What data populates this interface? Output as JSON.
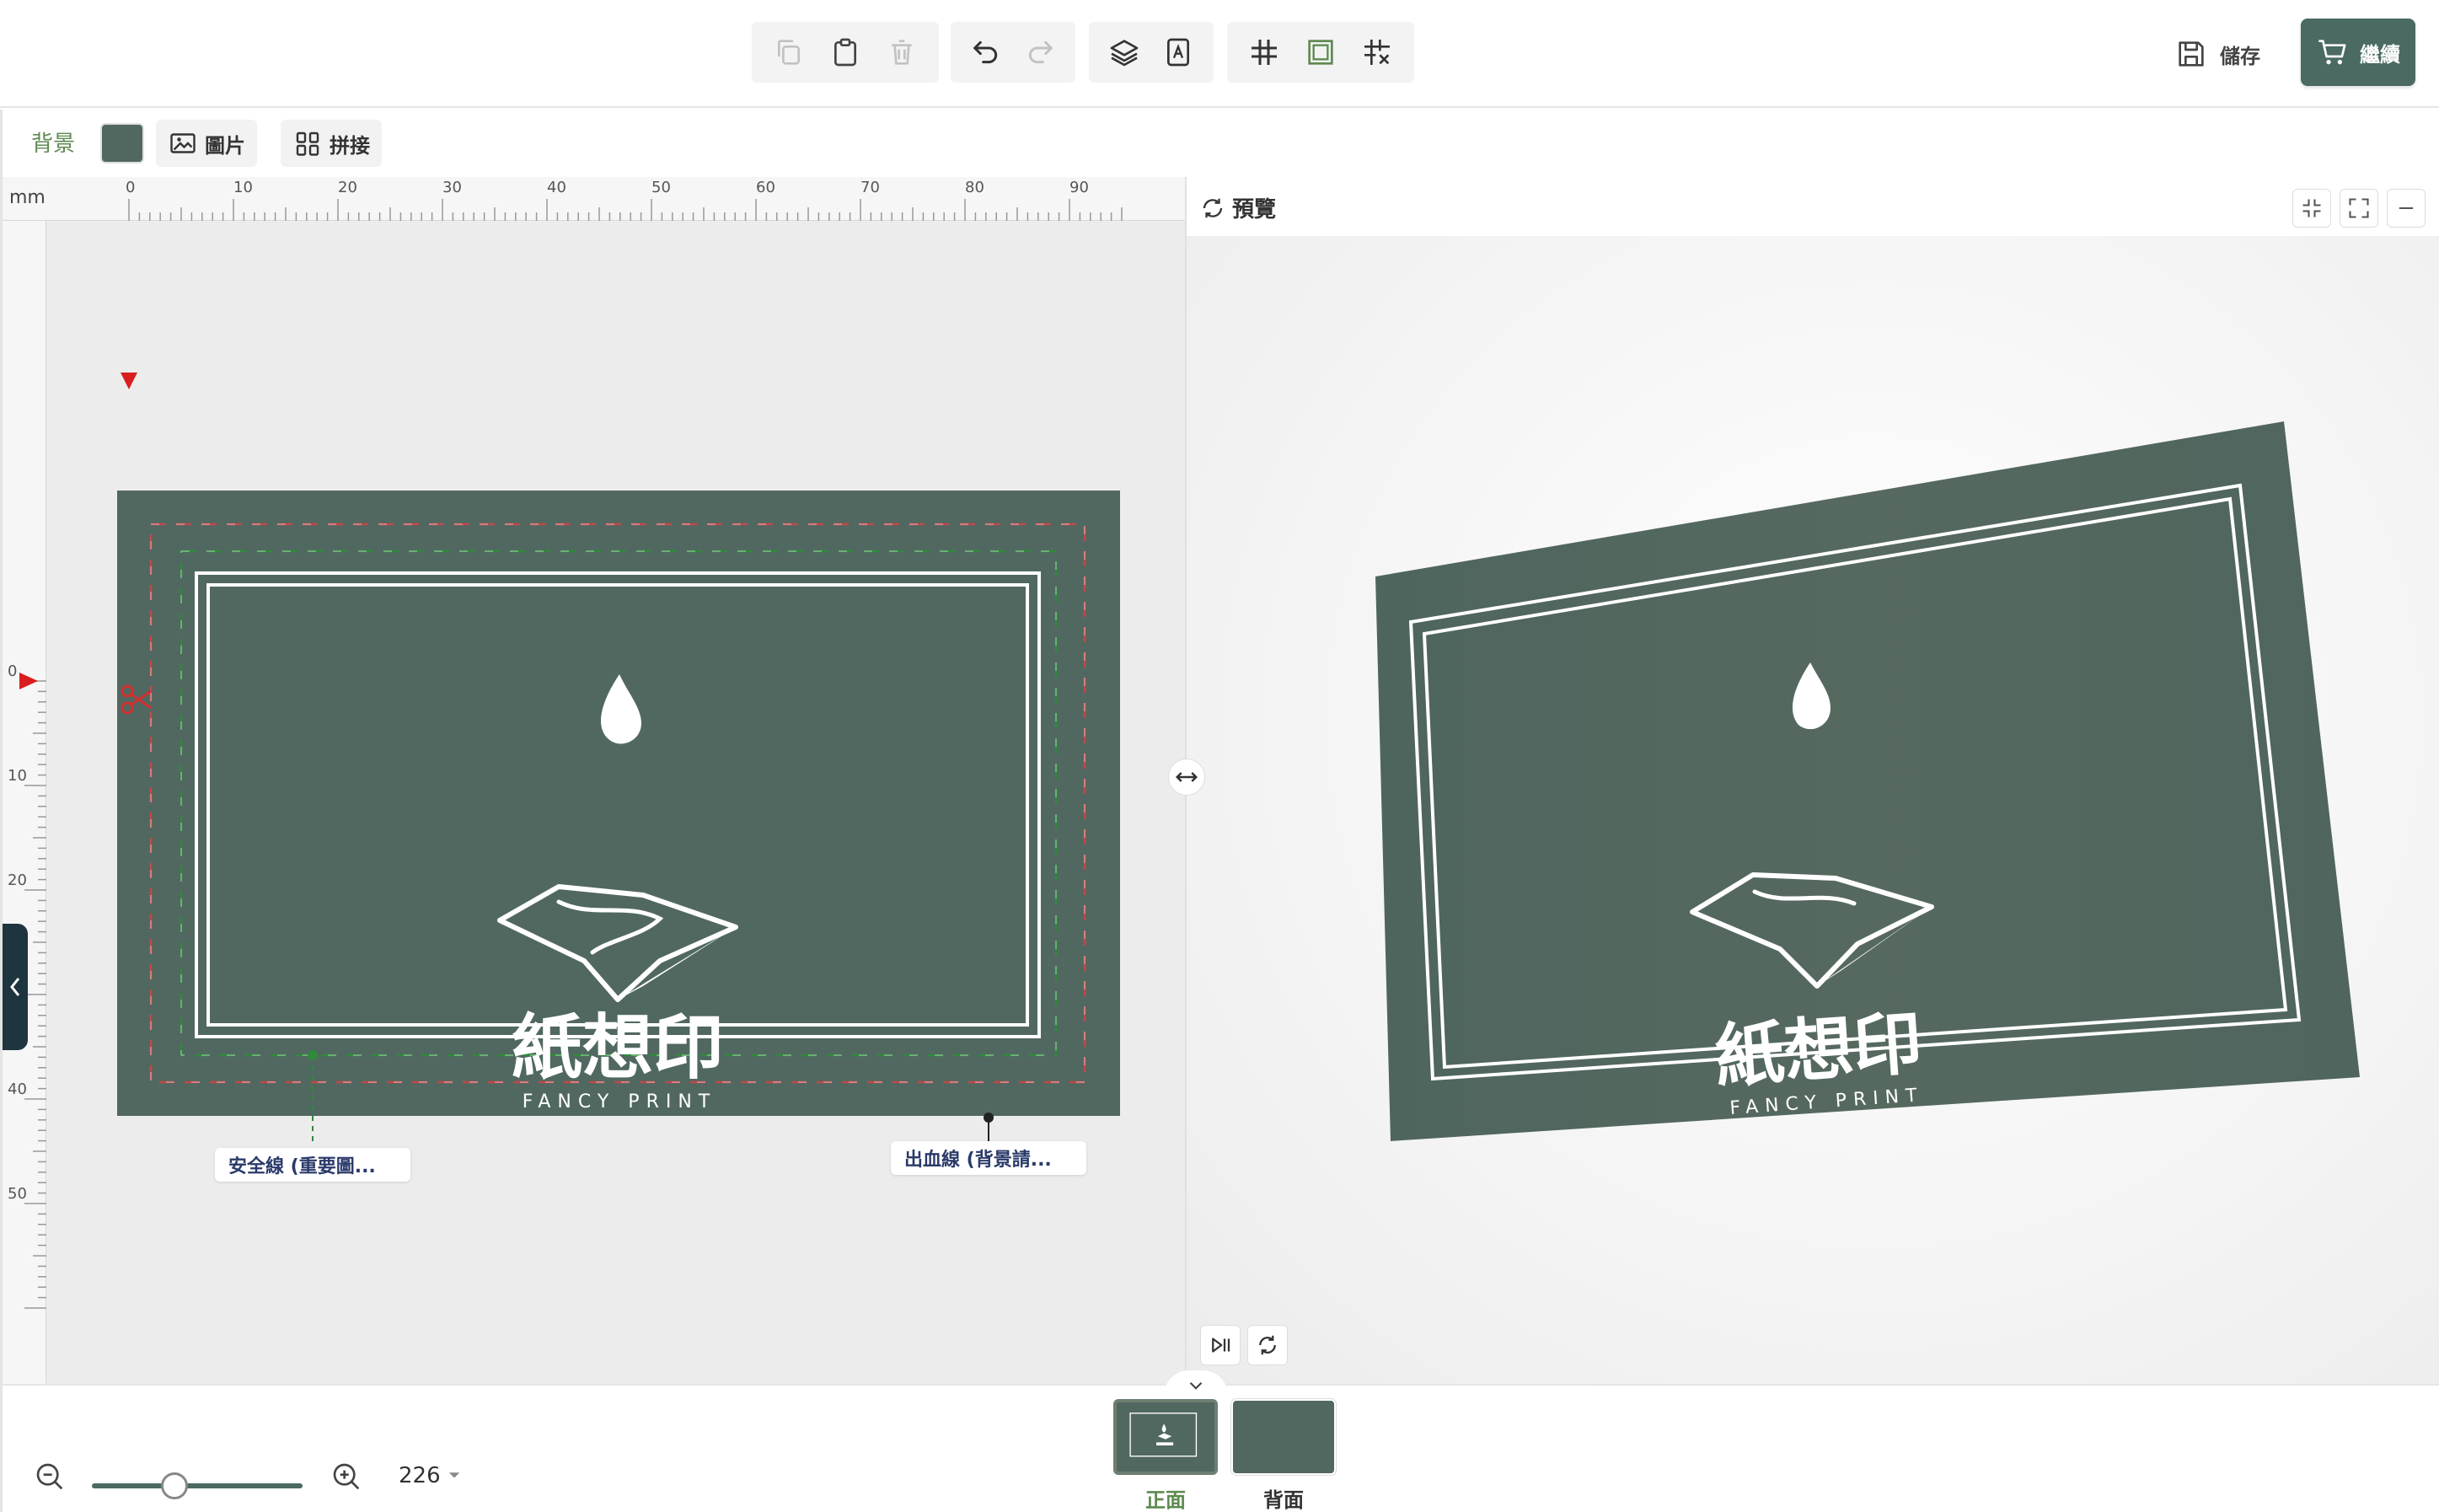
{
  "toolbar": {
    "save_label": "儲存",
    "continue_label": "繼續"
  },
  "subbar": {
    "background_label": "背景",
    "image_label": "圖片",
    "splice_label": "拼接",
    "background_color": "#516861"
  },
  "ruler": {
    "unit": "mm",
    "h_labels": [
      "0",
      "10",
      "20",
      "30",
      "40",
      "50",
      "60",
      "70",
      "80",
      "90"
    ],
    "v_labels": [
      "0",
      "10",
      "20",
      "40",
      "50"
    ]
  },
  "card": {
    "brand_cn": "紙想印",
    "brand_en": "FANCY PRINT",
    "color": "#516861"
  },
  "callouts": {
    "safety_line": "安全線 (重要圖...",
    "bleed_line": "出血線 (背景請..."
  },
  "preview": {
    "title": "預覽"
  },
  "zoom": {
    "value": "226"
  },
  "pages": {
    "front_label": "正面",
    "back_label": "背面"
  },
  "colors": {
    "accent": "#4a6a62",
    "label_green": "#5e8a50",
    "safety_line": "#2f8a3a",
    "bleed_line": "#c04848"
  },
  "icons": [
    "copy-icon",
    "paste-icon",
    "trash-icon",
    "undo-icon",
    "redo-icon",
    "layers-icon",
    "text-frame-icon",
    "grid-icon",
    "frame-icon",
    "grid-snap-icon",
    "save-icon",
    "cart-icon",
    "image-icon",
    "splice-icon",
    "preview-icon",
    "collapse-icon",
    "fullscreen-icon",
    "minimize-icon",
    "play-pause-icon",
    "rotate-icon",
    "zoom-out-icon",
    "zoom-in-icon",
    "chevron-down-icon",
    "scissors-icon"
  ]
}
